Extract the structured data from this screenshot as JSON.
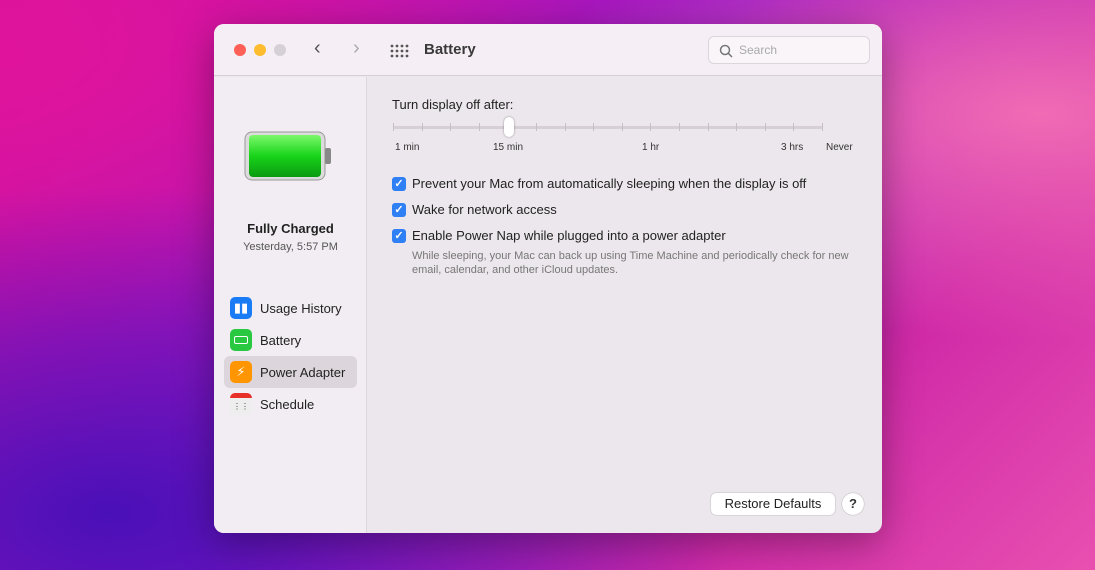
{
  "window": {
    "title": "Battery",
    "search_placeholder": "Search"
  },
  "battery_status": {
    "title": "Fully Charged",
    "time": "Yesterday, 5:57 PM"
  },
  "sidebar": {
    "items": [
      {
        "label": "Usage History",
        "icon": "chart-icon",
        "color": "#1a7cf5"
      },
      {
        "label": "Battery",
        "icon": "battery-icon",
        "color": "#28c840"
      },
      {
        "label": "Power Adapter",
        "icon": "bolt-icon",
        "color": "#ff9500",
        "selected": true
      },
      {
        "label": "Schedule",
        "icon": "calendar-icon",
        "color": "#e8e8e8"
      }
    ]
  },
  "slider": {
    "label": "Turn display off after:",
    "ticks": [
      "1 min",
      "15 min",
      "1 hr",
      "3 hrs",
      "Never"
    ],
    "value": "15 min",
    "position_index": 4,
    "tick_count": 16
  },
  "options": [
    {
      "label": "Prevent your Mac from automatically sleeping when the display is off",
      "checked": true
    },
    {
      "label": "Wake for network access",
      "checked": true
    },
    {
      "label": "Enable Power Nap while plugged into a power adapter",
      "checked": true
    }
  ],
  "power_nap_note": "While sleeping, your Mac can back up using Time Machine and periodically check for new email, calendar, and other iCloud updates.",
  "buttons": {
    "restore": "Restore Defaults",
    "help": "?"
  }
}
